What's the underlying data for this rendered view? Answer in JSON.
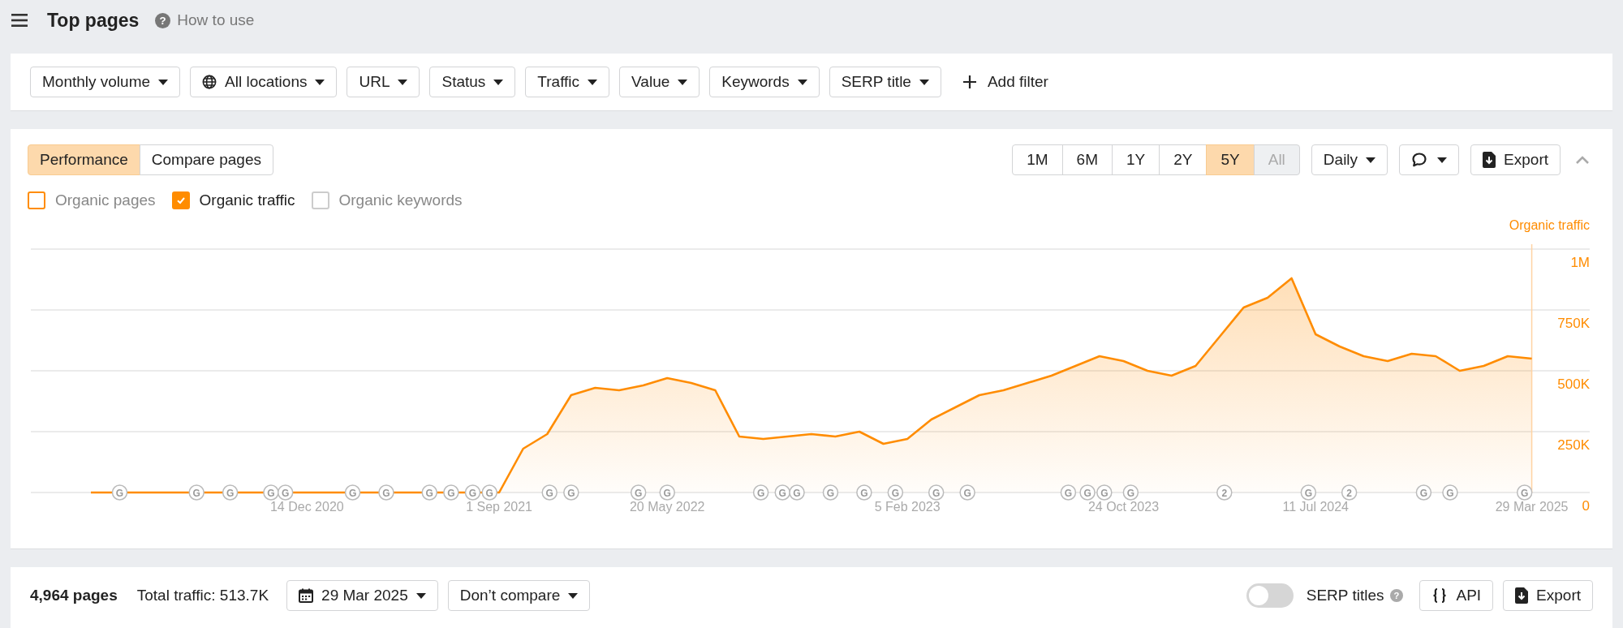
{
  "header": {
    "title": "Top pages",
    "help_icon": "?",
    "help_link": "How to use"
  },
  "filters": [
    {
      "label": "Monthly volume",
      "kind": "dropdown"
    },
    {
      "label": "All locations",
      "kind": "location"
    },
    {
      "label": "URL",
      "kind": "dropdown"
    },
    {
      "label": "Status",
      "kind": "dropdown"
    },
    {
      "label": "Traffic",
      "kind": "dropdown"
    },
    {
      "label": "Value",
      "kind": "dropdown"
    },
    {
      "label": "Keywords",
      "kind": "dropdown"
    },
    {
      "label": "SERP title",
      "kind": "dropdown"
    },
    {
      "label": "Add filter",
      "kind": "add"
    }
  ],
  "chart_panel": {
    "view_tabs": [
      {
        "label": "Performance",
        "selected": true
      },
      {
        "label": "Compare pages",
        "selected": false
      }
    ],
    "ranges": [
      {
        "label": "1M",
        "selected": false,
        "disabled": false
      },
      {
        "label": "6M",
        "selected": false,
        "disabled": false
      },
      {
        "label": "1Y",
        "selected": false,
        "disabled": false
      },
      {
        "label": "2Y",
        "selected": false,
        "disabled": false
      },
      {
        "label": "5Y",
        "selected": true,
        "disabled": false
      },
      {
        "label": "All",
        "selected": false,
        "disabled": true
      }
    ],
    "interval": "Daily",
    "export": "Export",
    "series_toggles": [
      {
        "label": "Organic pages",
        "checked": false,
        "color": "#ff8c00"
      },
      {
        "label": "Organic traffic",
        "checked": true,
        "color": "#ff8c00"
      },
      {
        "label": "Organic keywords",
        "checked": false,
        "color": "#cccccc"
      }
    ],
    "chart_data": {
      "type": "line",
      "categories": [
        null,
        null,
        null,
        null,
        null,
        null,
        null,
        null,
        null,
        "14 Dec 2020",
        null,
        null,
        null,
        null,
        null,
        null,
        null,
        "1 Sep 2021",
        null,
        null,
        null,
        null,
        null,
        null,
        "20 May 2022",
        null,
        null,
        null,
        null,
        null,
        null,
        null,
        null,
        null,
        "5 Feb 2023",
        null,
        null,
        null,
        null,
        null,
        null,
        null,
        null,
        "24 Oct 2023",
        null,
        null,
        null,
        null,
        null,
        null,
        null,
        "11 Jul 2024",
        null,
        null,
        null,
        null,
        null,
        null,
        null,
        null,
        "29 Mar 2025"
      ],
      "series": [
        {
          "name": "Organic traffic",
          "color": "#ff8c00",
          "values": [
            0,
            0,
            0,
            0,
            0,
            0,
            0,
            0,
            0,
            0,
            0,
            0,
            0,
            0,
            0,
            0,
            0,
            0,
            180000,
            240000,
            400000,
            430000,
            420000,
            440000,
            470000,
            450000,
            420000,
            230000,
            220000,
            230000,
            240000,
            230000,
            250000,
            200000,
            220000,
            300000,
            350000,
            400000,
            420000,
            450000,
            480000,
            520000,
            560000,
            540000,
            500000,
            480000,
            520000,
            640000,
            760000,
            800000,
            880000,
            650000,
            600000,
            560000,
            540000,
            570000,
            560000,
            500000,
            520000,
            560000,
            550000
          ]
        }
      ],
      "ylim": [
        0,
        1000000
      ],
      "yticks": [
        {
          "value": 0,
          "label": "0"
        },
        {
          "value": 250000,
          "label": "250K"
        },
        {
          "value": 500000,
          "label": "500K"
        },
        {
          "value": 750000,
          "label": "750K"
        },
        {
          "value": 1000000,
          "label": "1M"
        }
      ],
      "grid": true
    },
    "update_markers": [
      {
        "text": "G"
      },
      {
        "text": "G"
      },
      {
        "text": "G"
      },
      {
        "text": "G"
      },
      {
        "text": "G"
      },
      {
        "text": "G"
      },
      {
        "text": "G"
      },
      {
        "text": "G"
      },
      {
        "text": "G"
      },
      {
        "text": "G"
      },
      {
        "text": "G"
      },
      {
        "text": "G"
      },
      {
        "text": "G"
      },
      {
        "text": "G"
      },
      {
        "text": "G"
      },
      {
        "text": "G"
      },
      {
        "text": "G"
      },
      {
        "text": "G"
      },
      {
        "text": "G"
      },
      {
        "text": "G"
      },
      {
        "text": "G"
      },
      {
        "text": "G"
      },
      {
        "text": "G"
      },
      {
        "text": "G"
      },
      {
        "text": "G"
      },
      {
        "text": "G"
      },
      {
        "text": "G"
      },
      {
        "text": "2"
      },
      {
        "text": "G"
      },
      {
        "text": "2"
      },
      {
        "text": "G"
      },
      {
        "text": "G"
      },
      {
        "text": "G"
      }
    ]
  },
  "summary": {
    "pages": "4,964 pages",
    "total_traffic": "Total traffic: 513.7K",
    "date": "29 Mar 2025",
    "compare": "Don’t compare",
    "serp_titles": {
      "label": "SERP titles",
      "on": false,
      "help_icon": "?"
    },
    "api": "API",
    "export": "Export"
  }
}
